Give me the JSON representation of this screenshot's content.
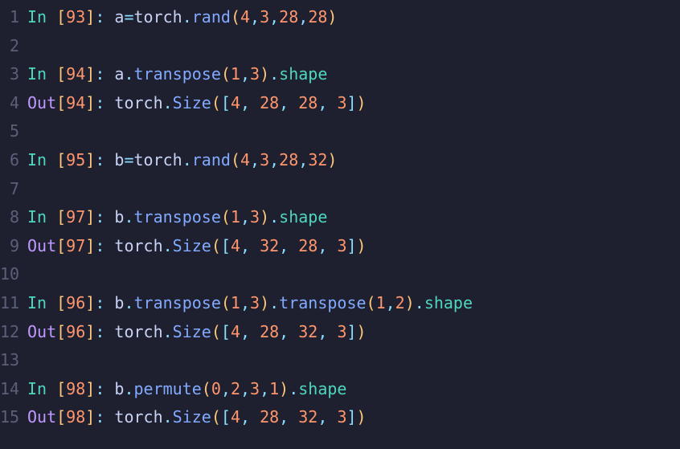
{
  "lines": [
    {
      "n": "1",
      "tokens": [
        {
          "c": "t-in",
          "t": "In "
        },
        {
          "c": "t-par",
          "t": "["
        },
        {
          "c": "t-num",
          "t": "93"
        },
        {
          "c": "t-par",
          "t": "]"
        },
        {
          "c": "t-col",
          "t": ": "
        },
        {
          "c": "t-var",
          "t": "a"
        },
        {
          "c": "t-op",
          "t": "="
        },
        {
          "c": "t-var",
          "t": "torch"
        },
        {
          "c": "t-pun",
          "t": "."
        },
        {
          "c": "t-fn",
          "t": "rand"
        },
        {
          "c": "t-par",
          "t": "("
        },
        {
          "c": "t-num",
          "t": "4"
        },
        {
          "c": "t-comma",
          "t": ","
        },
        {
          "c": "t-num",
          "t": "3"
        },
        {
          "c": "t-comma",
          "t": ","
        },
        {
          "c": "t-num",
          "t": "28"
        },
        {
          "c": "t-comma",
          "t": ","
        },
        {
          "c": "t-num",
          "t": "28"
        },
        {
          "c": "t-par",
          "t": ")"
        }
      ]
    },
    {
      "n": "2",
      "tokens": []
    },
    {
      "n": "3",
      "tokens": [
        {
          "c": "t-in",
          "t": "In "
        },
        {
          "c": "t-par",
          "t": "["
        },
        {
          "c": "t-num",
          "t": "94"
        },
        {
          "c": "t-par",
          "t": "]"
        },
        {
          "c": "t-col",
          "t": ": "
        },
        {
          "c": "t-var",
          "t": "a"
        },
        {
          "c": "t-pun",
          "t": "."
        },
        {
          "c": "t-fn",
          "t": "transpose"
        },
        {
          "c": "t-par",
          "t": "("
        },
        {
          "c": "t-num",
          "t": "1"
        },
        {
          "c": "t-comma",
          "t": ","
        },
        {
          "c": "t-num",
          "t": "3"
        },
        {
          "c": "t-par",
          "t": ")"
        },
        {
          "c": "t-pun",
          "t": "."
        },
        {
          "c": "t-attr",
          "t": "shape"
        }
      ]
    },
    {
      "n": "4",
      "tokens": [
        {
          "c": "t-out",
          "t": "Out"
        },
        {
          "c": "t-par",
          "t": "["
        },
        {
          "c": "t-num",
          "t": "94"
        },
        {
          "c": "t-par",
          "t": "]"
        },
        {
          "c": "t-col",
          "t": ": "
        },
        {
          "c": "t-var",
          "t": "torch"
        },
        {
          "c": "t-pun",
          "t": "."
        },
        {
          "c": "t-fn",
          "t": "Size"
        },
        {
          "c": "t-par",
          "t": "("
        },
        {
          "c": "t-br",
          "t": "["
        },
        {
          "c": "t-num",
          "t": "4"
        },
        {
          "c": "t-comma",
          "t": ", "
        },
        {
          "c": "t-num",
          "t": "28"
        },
        {
          "c": "t-comma",
          "t": ", "
        },
        {
          "c": "t-num",
          "t": "28"
        },
        {
          "c": "t-comma",
          "t": ", "
        },
        {
          "c": "t-num",
          "t": "3"
        },
        {
          "c": "t-br",
          "t": "]"
        },
        {
          "c": "t-par",
          "t": ")"
        }
      ]
    },
    {
      "n": "5",
      "tokens": []
    },
    {
      "n": "6",
      "tokens": [
        {
          "c": "t-in",
          "t": "In "
        },
        {
          "c": "t-par",
          "t": "["
        },
        {
          "c": "t-num",
          "t": "95"
        },
        {
          "c": "t-par",
          "t": "]"
        },
        {
          "c": "t-col",
          "t": ": "
        },
        {
          "c": "t-var",
          "t": "b"
        },
        {
          "c": "t-op",
          "t": "="
        },
        {
          "c": "t-var",
          "t": "torch"
        },
        {
          "c": "t-pun",
          "t": "."
        },
        {
          "c": "t-fn",
          "t": "rand"
        },
        {
          "c": "t-par",
          "t": "("
        },
        {
          "c": "t-num",
          "t": "4"
        },
        {
          "c": "t-comma",
          "t": ","
        },
        {
          "c": "t-num",
          "t": "3"
        },
        {
          "c": "t-comma",
          "t": ","
        },
        {
          "c": "t-num",
          "t": "28"
        },
        {
          "c": "t-comma",
          "t": ","
        },
        {
          "c": "t-num",
          "t": "32"
        },
        {
          "c": "t-par",
          "t": ")"
        }
      ]
    },
    {
      "n": "7",
      "tokens": []
    },
    {
      "n": "8",
      "tokens": [
        {
          "c": "t-in",
          "t": "In "
        },
        {
          "c": "t-par",
          "t": "["
        },
        {
          "c": "t-num",
          "t": "97"
        },
        {
          "c": "t-par",
          "t": "]"
        },
        {
          "c": "t-col",
          "t": ": "
        },
        {
          "c": "t-var",
          "t": "b"
        },
        {
          "c": "t-pun",
          "t": "."
        },
        {
          "c": "t-fn",
          "t": "transpose"
        },
        {
          "c": "t-par",
          "t": "("
        },
        {
          "c": "t-num",
          "t": "1"
        },
        {
          "c": "t-comma",
          "t": ","
        },
        {
          "c": "t-num",
          "t": "3"
        },
        {
          "c": "t-par",
          "t": ")"
        },
        {
          "c": "t-pun",
          "t": "."
        },
        {
          "c": "t-attr",
          "t": "shape"
        }
      ]
    },
    {
      "n": "9",
      "tokens": [
        {
          "c": "t-out",
          "t": "Out"
        },
        {
          "c": "t-par",
          "t": "["
        },
        {
          "c": "t-num",
          "t": "97"
        },
        {
          "c": "t-par",
          "t": "]"
        },
        {
          "c": "t-col",
          "t": ": "
        },
        {
          "c": "t-var",
          "t": "torch"
        },
        {
          "c": "t-pun",
          "t": "."
        },
        {
          "c": "t-fn",
          "t": "Size"
        },
        {
          "c": "t-par",
          "t": "("
        },
        {
          "c": "t-br",
          "t": "["
        },
        {
          "c": "t-num",
          "t": "4"
        },
        {
          "c": "t-comma",
          "t": ", "
        },
        {
          "c": "t-num",
          "t": "32"
        },
        {
          "c": "t-comma",
          "t": ", "
        },
        {
          "c": "t-num",
          "t": "28"
        },
        {
          "c": "t-comma",
          "t": ", "
        },
        {
          "c": "t-num",
          "t": "3"
        },
        {
          "c": "t-br",
          "t": "]"
        },
        {
          "c": "t-par",
          "t": ")"
        }
      ]
    },
    {
      "n": "10",
      "tokens": []
    },
    {
      "n": "11",
      "tokens": [
        {
          "c": "t-in",
          "t": "In "
        },
        {
          "c": "t-par",
          "t": "["
        },
        {
          "c": "t-num",
          "t": "96"
        },
        {
          "c": "t-par",
          "t": "]"
        },
        {
          "c": "t-col",
          "t": ": "
        },
        {
          "c": "t-var",
          "t": "b"
        },
        {
          "c": "t-pun",
          "t": "."
        },
        {
          "c": "t-fn",
          "t": "transpose"
        },
        {
          "c": "t-par",
          "t": "("
        },
        {
          "c": "t-num",
          "t": "1"
        },
        {
          "c": "t-comma",
          "t": ","
        },
        {
          "c": "t-num",
          "t": "3"
        },
        {
          "c": "t-par",
          "t": ")"
        },
        {
          "c": "t-pun",
          "t": "."
        },
        {
          "c": "t-fn",
          "t": "transpose"
        },
        {
          "c": "t-par",
          "t": "("
        },
        {
          "c": "t-num",
          "t": "1"
        },
        {
          "c": "t-comma",
          "t": ","
        },
        {
          "c": "t-num",
          "t": "2"
        },
        {
          "c": "t-par",
          "t": ")"
        },
        {
          "c": "t-pun",
          "t": "."
        },
        {
          "c": "t-attr",
          "t": "shape"
        }
      ]
    },
    {
      "n": "12",
      "tokens": [
        {
          "c": "t-out",
          "t": "Out"
        },
        {
          "c": "t-par",
          "t": "["
        },
        {
          "c": "t-num",
          "t": "96"
        },
        {
          "c": "t-par",
          "t": "]"
        },
        {
          "c": "t-col",
          "t": ": "
        },
        {
          "c": "t-var",
          "t": "torch"
        },
        {
          "c": "t-pun",
          "t": "."
        },
        {
          "c": "t-fn",
          "t": "Size"
        },
        {
          "c": "t-par",
          "t": "("
        },
        {
          "c": "t-br",
          "t": "["
        },
        {
          "c": "t-num",
          "t": "4"
        },
        {
          "c": "t-comma",
          "t": ", "
        },
        {
          "c": "t-num",
          "t": "28"
        },
        {
          "c": "t-comma",
          "t": ", "
        },
        {
          "c": "t-num",
          "t": "32"
        },
        {
          "c": "t-comma",
          "t": ", "
        },
        {
          "c": "t-num",
          "t": "3"
        },
        {
          "c": "t-br",
          "t": "]"
        },
        {
          "c": "t-par",
          "t": ")"
        }
      ]
    },
    {
      "n": "13",
      "tokens": []
    },
    {
      "n": "14",
      "tokens": [
        {
          "c": "t-in",
          "t": "In "
        },
        {
          "c": "t-par",
          "t": "["
        },
        {
          "c": "t-num",
          "t": "98"
        },
        {
          "c": "t-par",
          "t": "]"
        },
        {
          "c": "t-col",
          "t": ": "
        },
        {
          "c": "t-var",
          "t": "b"
        },
        {
          "c": "t-pun",
          "t": "."
        },
        {
          "c": "t-fn",
          "t": "permute"
        },
        {
          "c": "t-par",
          "t": "("
        },
        {
          "c": "t-num",
          "t": "0"
        },
        {
          "c": "t-comma",
          "t": ","
        },
        {
          "c": "t-num",
          "t": "2"
        },
        {
          "c": "t-comma",
          "t": ","
        },
        {
          "c": "t-num",
          "t": "3"
        },
        {
          "c": "t-comma",
          "t": ","
        },
        {
          "c": "t-num",
          "t": "1"
        },
        {
          "c": "t-par",
          "t": ")"
        },
        {
          "c": "t-pun",
          "t": "."
        },
        {
          "c": "t-attr",
          "t": "shape"
        }
      ]
    },
    {
      "n": "15",
      "tokens": [
        {
          "c": "t-out",
          "t": "Out"
        },
        {
          "c": "t-par",
          "t": "["
        },
        {
          "c": "t-num",
          "t": "98"
        },
        {
          "c": "t-par",
          "t": "]"
        },
        {
          "c": "t-col",
          "t": ": "
        },
        {
          "c": "t-var",
          "t": "torch"
        },
        {
          "c": "t-pun",
          "t": "."
        },
        {
          "c": "t-fn",
          "t": "Size"
        },
        {
          "c": "t-par",
          "t": "("
        },
        {
          "c": "t-br",
          "t": "["
        },
        {
          "c": "t-num",
          "t": "4"
        },
        {
          "c": "t-comma",
          "t": ", "
        },
        {
          "c": "t-num",
          "t": "28"
        },
        {
          "c": "t-comma",
          "t": ", "
        },
        {
          "c": "t-num",
          "t": "32"
        },
        {
          "c": "t-comma",
          "t": ", "
        },
        {
          "c": "t-num",
          "t": "3"
        },
        {
          "c": "t-br",
          "t": "]"
        },
        {
          "c": "t-par",
          "t": ")"
        }
      ]
    }
  ]
}
